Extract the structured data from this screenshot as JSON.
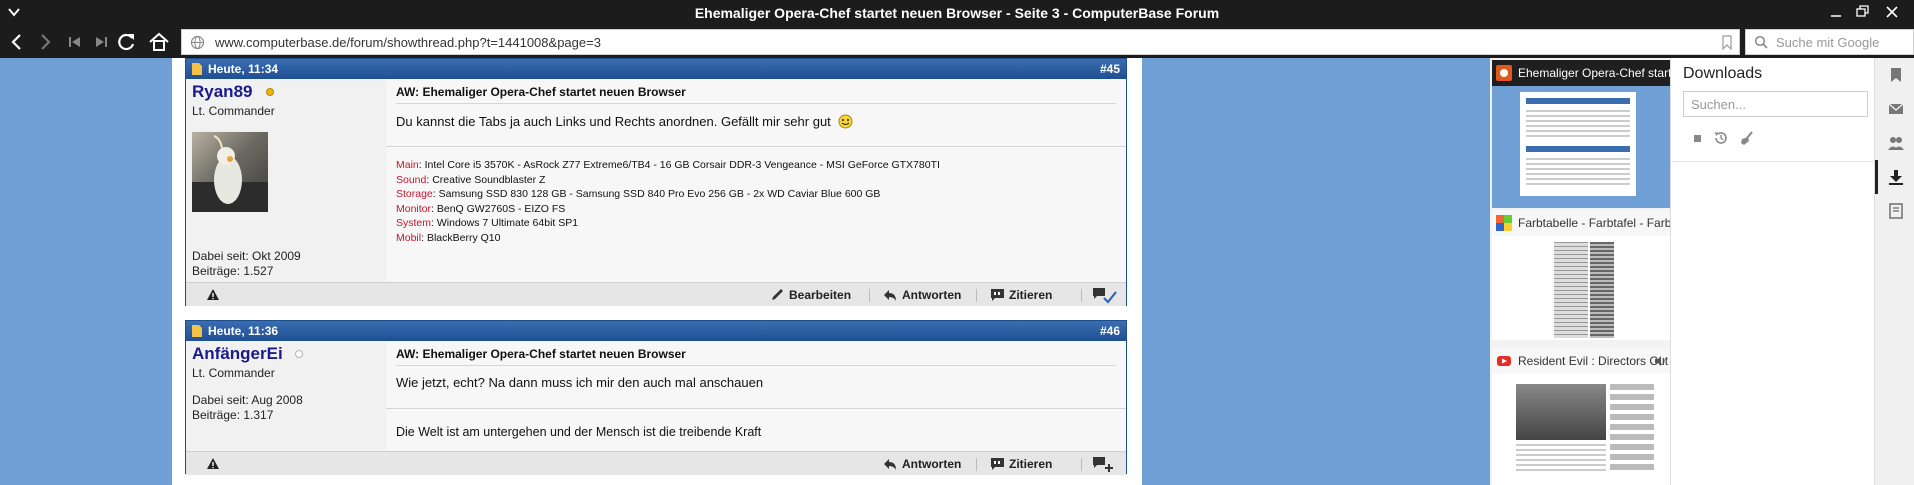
{
  "window": {
    "title": "Ehemaliger Opera-Chef startet neuen Browser - Seite 3 - ComputerBase Forum"
  },
  "toolbar": {
    "url": "www.computerbase.de/forum/showthread.php?t=1441008&page=3",
    "search_placeholder": "Suche mit Google"
  },
  "posts": [
    {
      "date": "Heute, 11:34",
      "number": "#45",
      "username": "Ryan89",
      "rank": "Lt. Commander",
      "joined": "Dabei seit: Okt 2009",
      "count": "Beiträge: 1.527",
      "title": "AW: Ehemaliger Opera-Chef startet neuen Browser",
      "text": "Du kannst die Tabs ja auch Links und Rechts anordnen. Gefällt mir sehr gut",
      "signature": [
        {
          "k": "Main",
          "v": "Intel Core i5 3570K - AsRock Z77 Extreme6/TB4 - 16 GB Corsair DDR-3 Vengeance - MSI GeForce GTX780TI"
        },
        {
          "k": "Sound",
          "v": "Creative Soundblaster Z"
        },
        {
          "k": "Storage",
          "v": "Samsung SSD 830 128 GB - Samsung SSD 840 Pro Evo 256 GB - 2x WD Caviar Blue 600 GB"
        },
        {
          "k": "Monitor",
          "v": "BenQ GW2760S - EIZO FS"
        },
        {
          "k": "System",
          "v": "Windows 7 Ultimate 64bit SP1"
        },
        {
          "k": "Mobil",
          "v": "BlackBerry Q10"
        }
      ],
      "actions": {
        "edit": "Bearbeiten",
        "reply": "Antworten",
        "quote": "Zitieren"
      }
    },
    {
      "date": "Heute, 11:36",
      "number": "#46",
      "username": "AnfängerEi",
      "rank": "Lt. Commander",
      "joined": "Dabei seit: Aug 2008",
      "count": "Beiträge: 1.317",
      "title": "AW: Ehemaliger Opera-Chef startet neuen Browser",
      "text": "Wie jetzt, echt? Na dann muss ich mir den auch mal anschauen",
      "signature_text": "Die Welt ist am untergehen und der Mensch ist die treibende Kraft",
      "actions": {
        "reply": "Antworten",
        "quote": "Zitieren"
      }
    }
  ],
  "tabs": [
    {
      "title": "Ehemaliger Opera-Chef startet neuen Browser"
    },
    {
      "title": "Farbtabelle - Farbtafel - Farbcodes"
    },
    {
      "title": "Resident Evil : Directors Cut"
    }
  ],
  "downloads": {
    "title": "Downloads",
    "search_placeholder": "Suchen..."
  },
  "colors": {
    "header_blue": "#1e4f92",
    "background": "#6f9fd4",
    "signature_key": "#c3172e",
    "online": "#e8b50d",
    "offline": "#b5b5b5"
  }
}
